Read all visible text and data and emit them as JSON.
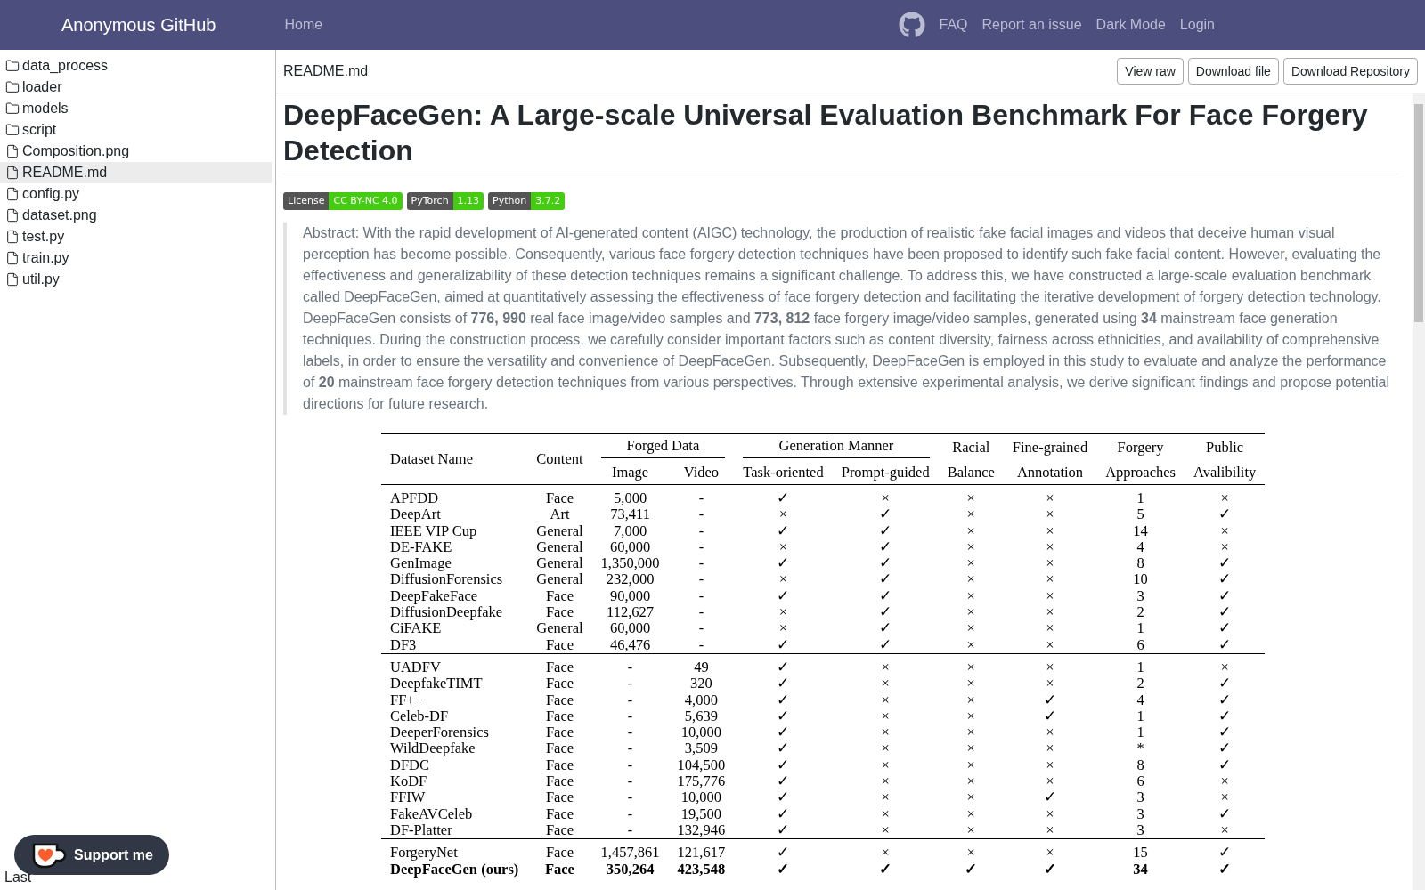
{
  "navbar": {
    "brand": "Anonymous GitHub",
    "links": [
      {
        "label": "Home"
      }
    ],
    "right_links": [
      {
        "label": "FAQ"
      },
      {
        "label": "Report an issue"
      },
      {
        "label": "Dark Mode"
      },
      {
        "label": "Login"
      }
    ]
  },
  "sidebar": {
    "items": [
      {
        "kind": "folder",
        "name": "data_process",
        "selected": false
      },
      {
        "kind": "folder",
        "name": "loader",
        "selected": false
      },
      {
        "kind": "folder",
        "name": "models",
        "selected": false
      },
      {
        "kind": "folder",
        "name": "script",
        "selected": false
      },
      {
        "kind": "file",
        "name": "Composition.png",
        "selected": false
      },
      {
        "kind": "file",
        "name": "README.md",
        "selected": true
      },
      {
        "kind": "file",
        "name": "config.py",
        "selected": false
      },
      {
        "kind": "file",
        "name": "dataset.png",
        "selected": false
      },
      {
        "kind": "file",
        "name": "test.py",
        "selected": false
      },
      {
        "kind": "file",
        "name": "train.py",
        "selected": false
      },
      {
        "kind": "file",
        "name": "util.py",
        "selected": false
      }
    ],
    "last_update": "Last",
    "support_button": "Support me"
  },
  "file_bar": {
    "filename": "README.md",
    "buttons": [
      "View raw",
      "Download file",
      "Download Repository"
    ]
  },
  "readme": {
    "title": "DeepFaceGen: A Large-scale Universal Evaluation Benchmark For Face Forgery Detection",
    "badges": [
      {
        "label": "License",
        "value": "CC BY-NC 4.0"
      },
      {
        "label": "PyTorch",
        "value": "1.13"
      },
      {
        "label": "Python",
        "value": "3.7.2"
      }
    ],
    "abstract": "Abstract: With the rapid development of AI-generated content (AIGC) technology, the production of realistic fake facial images and videos that deceive human visual perception has become possible. Consequently, various face forgery detection techniques have been proposed to identify such fake facial content. However, evaluating the effectiveness and generalizability of these detection techniques remains a significant challenge. To address this, we have constructed a large-scale evaluation benchmark called DeepFaceGen, aimed at quantitatively assessing the effectiveness of face forgery detection and facilitating the iterative development of forgery detection technology. DeepFaceGen consists of **776, 990** real face image/video samples and **773, 812** face forgery image/video samples, generated using **34** mainstream face generation techniques. During the construction process, we carefully consider important factors such as content diversity, fairness across ethnicities, and availability of comprehensive labels, in order to ensure the versatility and convenience of DeepFaceGen. Subsequently, DeepFaceGen is employed in this study to evaluate and analyze the performance of **20** mainstream face forgery detection techniques from various perspectives. Through extensive experimental analysis, we derive significant findings and propose potential directions for future research.",
    "table": {
      "header": [
        {
          "kind": "single",
          "lines": [
            "Dataset Name"
          ]
        },
        {
          "kind": "single",
          "lines": [
            "Content"
          ]
        },
        {
          "kind": "group",
          "group": "Forged Data",
          "columns": [
            "Image",
            "Video"
          ]
        },
        {
          "kind": "group",
          "group": "Generation Manner",
          "columns": [
            "Task-oriented",
            "Prompt-guided"
          ]
        },
        {
          "kind": "single",
          "lines": [
            "Racial",
            "Balance"
          ]
        },
        {
          "kind": "single",
          "lines": [
            "Fine-grained",
            "Annotation"
          ]
        },
        {
          "kind": "single",
          "lines": [
            "Forgery",
            "Approaches"
          ]
        },
        {
          "kind": "single",
          "lines": [
            "Public",
            "Avalibility"
          ]
        }
      ],
      "groups": [
        [
          {
            "bold": false,
            "cells": [
              "APFDD",
              "Face",
              "5,000",
              "-",
              "✓",
              "×",
              "×",
              "×",
              "1",
              "×"
            ]
          },
          {
            "bold": false,
            "cells": [
              "DeepArt",
              "Art",
              "73,411",
              "-",
              "×",
              "✓",
              "×",
              "×",
              "5",
              "✓"
            ]
          },
          {
            "bold": false,
            "cells": [
              "IEEE VIP Cup",
              "General",
              "7,000",
              "-",
              "✓",
              "✓",
              "×",
              "×",
              "14",
              "×"
            ]
          },
          {
            "bold": false,
            "cells": [
              "DE-FAKE",
              "General",
              "60,000",
              "-",
              "×",
              "✓",
              "×",
              "×",
              "4",
              "×"
            ]
          },
          {
            "bold": false,
            "cells": [
              "GenImage",
              "General",
              "1,350,000",
              "-",
              "✓",
              "✓",
              "×",
              "×",
              "8",
              "✓"
            ]
          },
          {
            "bold": false,
            "cells": [
              "DiffusionForensics",
              "General",
              "232,000",
              "-",
              "×",
              "✓",
              "×",
              "×",
              "10",
              "✓"
            ]
          },
          {
            "bold": false,
            "cells": [
              "DeepFakeFace",
              "Face",
              "90,000",
              "-",
              "✓",
              "✓",
              "×",
              "×",
              "3",
              "✓"
            ]
          },
          {
            "bold": false,
            "cells": [
              "DiffusionDeepfake",
              "Face",
              "112,627",
              "-",
              "×",
              "✓",
              "×",
              "×",
              "2",
              "✓"
            ]
          },
          {
            "bold": false,
            "cells": [
              "CiFAKE",
              "General",
              "60,000",
              "-",
              "×",
              "✓",
              "×",
              "×",
              "1",
              "✓"
            ]
          },
          {
            "bold": false,
            "cells": [
              "DF3",
              "Face",
              "46,476",
              "-",
              "✓",
              "✓",
              "×",
              "×",
              "6",
              "✓"
            ]
          }
        ],
        [
          {
            "bold": false,
            "cells": [
              "UADFV",
              "Face",
              "-",
              "49",
              "✓",
              "×",
              "×",
              "×",
              "1",
              "×"
            ]
          },
          {
            "bold": false,
            "cells": [
              "DeepfakeTIMT",
              "Face",
              "-",
              "320",
              "✓",
              "×",
              "×",
              "×",
              "2",
              "✓"
            ]
          },
          {
            "bold": false,
            "cells": [
              "FF++",
              "Face",
              "-",
              "4,000",
              "✓",
              "×",
              "×",
              "✓",
              "4",
              "✓"
            ]
          },
          {
            "bold": false,
            "cells": [
              "Celeb-DF",
              "Face",
              "-",
              "5,639",
              "✓",
              "×",
              "×",
              "✓",
              "1",
              "✓"
            ]
          },
          {
            "bold": false,
            "cells": [
              "DeeperForensics",
              "Face",
              "-",
              "10,000",
              "✓",
              "×",
              "×",
              "×",
              "1",
              "✓"
            ]
          },
          {
            "bold": false,
            "cells": [
              "WildDeepfake",
              "Face",
              "-",
              "3,509",
              "✓",
              "×",
              "×",
              "×",
              "*",
              "✓"
            ]
          },
          {
            "bold": false,
            "cells": [
              "DFDC",
              "Face",
              "-",
              "104,500",
              "✓",
              "×",
              "×",
              "×",
              "8",
              "✓"
            ]
          },
          {
            "bold": false,
            "cells": [
              "KoDF",
              "Face",
              "-",
              "175,776",
              "✓",
              "×",
              "×",
              "×",
              "6",
              "×"
            ]
          },
          {
            "bold": false,
            "cells": [
              "FFIW",
              "Face",
              "-",
              "10,000",
              "✓",
              "×",
              "×",
              "✓",
              "3",
              "×"
            ]
          },
          {
            "bold": false,
            "cells": [
              "FakeAVCeleb",
              "Face",
              "-",
              "19,500",
              "✓",
              "×",
              "×",
              "×",
              "3",
              "✓"
            ]
          },
          {
            "bold": false,
            "cells": [
              "DF-Platter",
              "Face",
              "-",
              "132,946",
              "✓",
              "×",
              "×",
              "×",
              "3",
              "×"
            ]
          }
        ],
        [
          {
            "bold": false,
            "cells": [
              "ForgeryNet",
              "Face",
              "1,457,861",
              "121,617",
              "✓",
              "×",
              "×",
              "×",
              "15",
              "✓"
            ]
          },
          {
            "bold": true,
            "cells": [
              "DeepFaceGen (ours)",
              "Face",
              "350,264",
              "423,548",
              "✓",
              "✓",
              "✓",
              "✓",
              "34",
              "✓"
            ]
          }
        ]
      ]
    }
  }
}
